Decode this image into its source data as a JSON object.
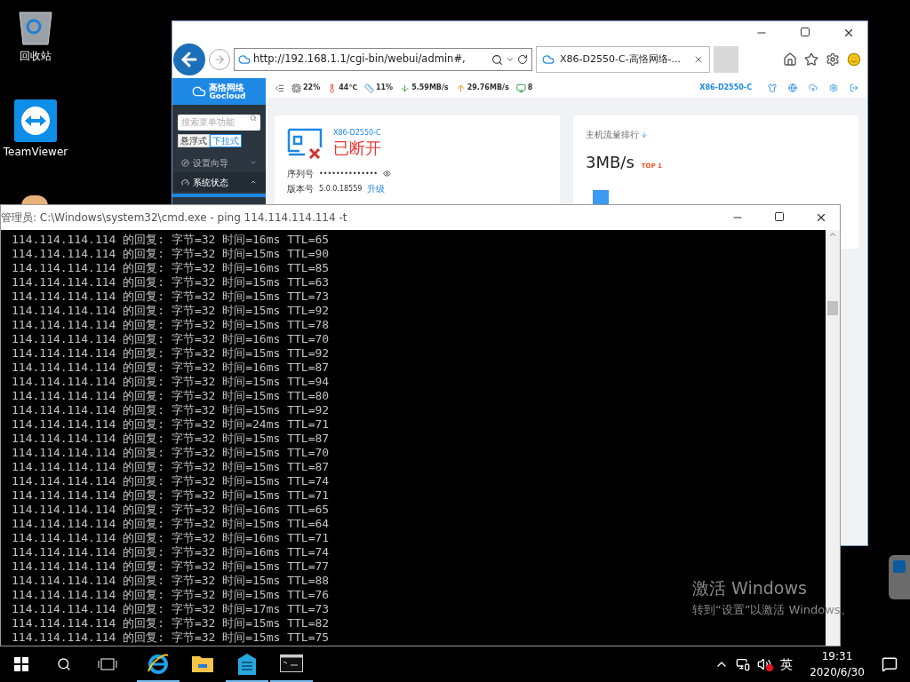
{
  "desktop_icons": [
    {
      "kind": "recycle-bin",
      "label": "回收站"
    },
    {
      "kind": "teamviewer",
      "label": "TeamViewer"
    },
    {
      "kind": "partial"
    }
  ],
  "browser": {
    "address": "http://192.168.1.1/cgi-bin/webui/admin#,",
    "tabs": [
      {
        "title": "X86-D2550-C-高恪网络-...",
        "selected": true
      }
    ],
    "router_ui": {
      "logo": {
        "name": "高恪网络",
        "sub": "Gocloud"
      },
      "stats": [
        {
          "kind": "cpu",
          "value": "22%"
        },
        {
          "kind": "temp",
          "value": "44℃"
        },
        {
          "kind": "memory",
          "value": "11%"
        },
        {
          "kind": "down",
          "value": "5.59MB/s"
        },
        {
          "kind": "up",
          "value": "29.76MB/s"
        },
        {
          "kind": "hosts",
          "value": "8"
        }
      ],
      "device_name": "X86-D2550-C",
      "sidebar": {
        "search_placeholder": "搜索菜单功能",
        "modes": [
          {
            "label": "悬浮式",
            "selected": false
          },
          {
            "label": "下拉式",
            "selected": true
          }
        ],
        "items": [
          {
            "kind": "compass",
            "label": "设置向导",
            "expanded": false
          },
          {
            "kind": "gauge",
            "label": "系统状态",
            "expanded": true
          }
        ]
      },
      "device_card": {
        "name": "X86-D2550-C",
        "status": "已断开",
        "serial_label": "序列号",
        "serial_value": "••••••••••••••",
        "version_label": "版本号",
        "version_value": "5.0.0.18559",
        "upgrade_link": "升级"
      },
      "traffic_card": {
        "title": "主机流量排行",
        "value": "3MB/s",
        "rank": "TOP 1"
      }
    }
  },
  "cmd": {
    "title": "管理员: C:\\Windows\\system32\\cmd.exe - ping  114.114.114.114 -t",
    "lines": [
      "114.114.114.114 的回复: 字节=32 时间=16ms TTL=65",
      "114.114.114.114 的回复: 字节=32 时间=15ms TTL=90",
      "114.114.114.114 的回复: 字节=32 时间=16ms TTL=85",
      "114.114.114.114 的回复: 字节=32 时间=15ms TTL=63",
      "114.114.114.114 的回复: 字节=32 时间=15ms TTL=73",
      "114.114.114.114 的回复: 字节=32 时间=15ms TTL=92",
      "114.114.114.114 的回复: 字节=32 时间=15ms TTL=78",
      "114.114.114.114 的回复: 字节=32 时间=16ms TTL=70",
      "114.114.114.114 的回复: 字节=32 时间=15ms TTL=92",
      "114.114.114.114 的回复: 字节=32 时间=16ms TTL=87",
      "114.114.114.114 的回复: 字节=32 时间=15ms TTL=94",
      "114.114.114.114 的回复: 字节=32 时间=15ms TTL=80",
      "114.114.114.114 的回复: 字节=32 时间=15ms TTL=92",
      "114.114.114.114 的回复: 字节=32 时间=24ms TTL=71",
      "114.114.114.114 的回复: 字节=32 时间=15ms TTL=87",
      "114.114.114.114 的回复: 字节=32 时间=15ms TTL=70",
      "114.114.114.114 的回复: 字节=32 时间=15ms TTL=87",
      "114.114.114.114 的回复: 字节=32 时间=15ms TTL=74",
      "114.114.114.114 的回复: 字节=32 时间=15ms TTL=71",
      "114.114.114.114 的回复: 字节=32 时间=16ms TTL=65",
      "114.114.114.114 的回复: 字节=32 时间=15ms TTL=64",
      "114.114.114.114 的回复: 字节=32 时间=16ms TTL=71",
      "114.114.114.114 的回复: 字节=32 时间=16ms TTL=74",
      "114.114.114.114 的回复: 字节=32 时间=15ms TTL=77",
      "114.114.114.114 的回复: 字节=32 时间=15ms TTL=88",
      "114.114.114.114 的回复: 字节=32 时间=15ms TTL=76",
      "114.114.114.114 的回复: 字节=32 时间=17ms TTL=73",
      "114.114.114.114 的回复: 字节=32 时间=15ms TTL=82",
      "114.114.114.114 的回复: 字节=32 时间=15ms TTL=75"
    ]
  },
  "activation": {
    "title": "激活 Windows",
    "subtitle": "转到“设置”以激活 Windows。"
  },
  "taskbar": {
    "apps": [
      {
        "kind": "ie",
        "running": true
      },
      {
        "kind": "explorer",
        "running": false
      },
      {
        "kind": "building",
        "running": true
      },
      {
        "kind": "cmd",
        "running": true
      }
    ],
    "ime": "英",
    "time": "19:31",
    "date": "2020/6/30"
  }
}
